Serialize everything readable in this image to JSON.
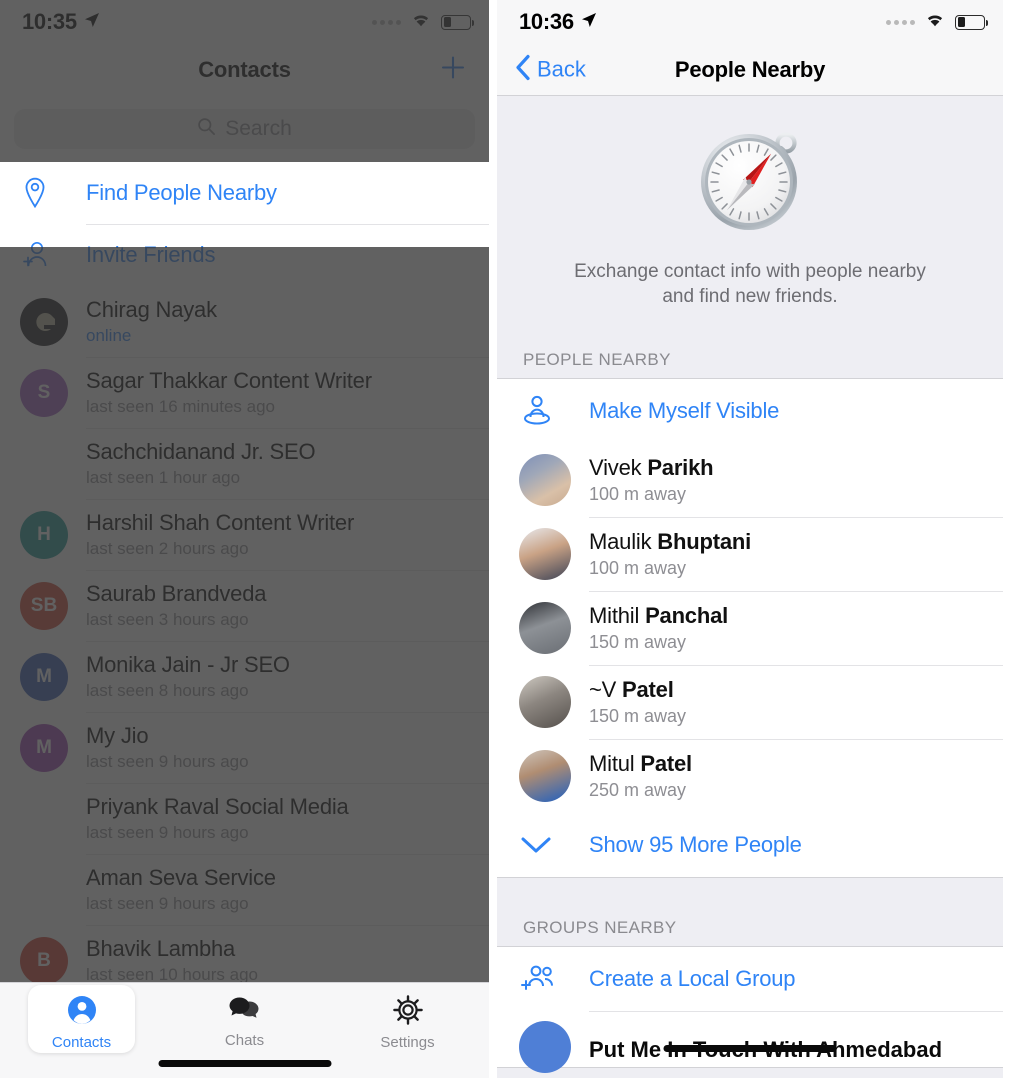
{
  "left": {
    "status": {
      "time": "10:35",
      "location_icon": "location-arrow-icon",
      "battery_level": "30"
    },
    "navbar": {
      "title": "Contacts",
      "add_icon": "plus-icon"
    },
    "search": {
      "placeholder": "Search",
      "icon": "search-icon"
    },
    "actions": [
      {
        "label": "Find People Nearby",
        "icon": "map-pin-icon",
        "highlighted": true
      },
      {
        "label": "Invite Friends",
        "icon": "person-add-icon",
        "highlighted": false
      }
    ],
    "contacts": [
      {
        "name": "Chirag Nayak",
        "status": "online",
        "online": true,
        "initials": "G",
        "color": "#17171a"
      },
      {
        "name": "Sagar Thakkar Content Writer",
        "status": "last seen 16 minutes ago",
        "online": false,
        "initials": "S",
        "color": "#a259c4"
      },
      {
        "name": "Sachchidanand Jr. SEO",
        "status": "last seen 1 hour ago",
        "online": false,
        "initials": "",
        "color": ""
      },
      {
        "name": "Harshil Shah Content Writer",
        "status": "last seen 2 hours ago",
        "online": false,
        "initials": "H",
        "color": "#16968f"
      },
      {
        "name": "Saurab Brandveda",
        "status": "last seen 3 hours ago",
        "online": false,
        "initials": "SB",
        "color": "#d0412e"
      },
      {
        "name": "Monika Jain - Jr SEO",
        "status": "last seen 8 hours ago",
        "online": false,
        "initials": "M",
        "color": "#2f56b5"
      },
      {
        "name": "My Jio",
        "status": "last seen 9 hours ago",
        "online": false,
        "initials": "M",
        "color": "#9c3fb5"
      },
      {
        "name": "Priyank Raval Social Media",
        "status": "last seen 9 hours ago",
        "online": false,
        "initials": "",
        "color": ""
      },
      {
        "name": "Aman Seva Service",
        "status": "last seen 9 hours ago",
        "online": false,
        "initials": "",
        "color": ""
      },
      {
        "name": "Bhavik Lambha",
        "status": "last seen 10 hours ago",
        "online": false,
        "initials": "B",
        "color": "#cf3b2c"
      }
    ],
    "tabs": [
      {
        "label": "Contacts",
        "icon": "person-circle-icon",
        "active": true
      },
      {
        "label": "Chats",
        "icon": "chat-bubbles-icon",
        "active": false
      },
      {
        "label": "Settings",
        "icon": "gear-icon",
        "active": false
      }
    ]
  },
  "right": {
    "status": {
      "time": "10:36",
      "location_icon": "location-arrow-icon",
      "battery_level": "30"
    },
    "navbar": {
      "back_label": "Back",
      "back_icon": "chevron-left-icon",
      "title": "People Nearby"
    },
    "hero": {
      "icon": "compass-icon",
      "description_line1": "Exchange contact info with people nearby",
      "description_line2": "and find new friends."
    },
    "sections": [
      {
        "header": "PEOPLE NEARBY"
      },
      {
        "header": "GROUPS NEARBY"
      }
    ],
    "visible_action": {
      "label": "Make Myself Visible",
      "icon": "person-location-icon"
    },
    "people": [
      {
        "first": "Vivek ",
        "last": "Parikh",
        "distance": "100 m away",
        "avatar": "photo-sunglasses"
      },
      {
        "first": "Maulik ",
        "last": "Bhuptani",
        "distance": "100 m away",
        "avatar": "photo-suit"
      },
      {
        "first": "Mithil ",
        "last": "Panchal",
        "distance": "150 m away",
        "avatar": "photo-glasses-bw"
      },
      {
        "first": "~V ",
        "last": "Patel",
        "distance": "150 m away",
        "avatar": "photo-outdoor"
      },
      {
        "first": "Mitul ",
        "last": "Patel",
        "distance": "250 m away",
        "avatar": "photo-blue-shirt"
      }
    ],
    "show_more": {
      "label": "Show 95 More People",
      "icon": "chevron-down-icon"
    },
    "create_group": {
      "label": "Create a Local Group",
      "icon": "people-add-icon"
    },
    "groups": [
      {
        "name": "Put Me In Touch With Ahmedabad",
        "color": "#4f7fd6"
      }
    ]
  },
  "colors": {
    "accent": "#2f84f6",
    "secondary_text": "#8e8e93",
    "group_bg": "#eeeef3",
    "separator": "#e3e3e6"
  }
}
